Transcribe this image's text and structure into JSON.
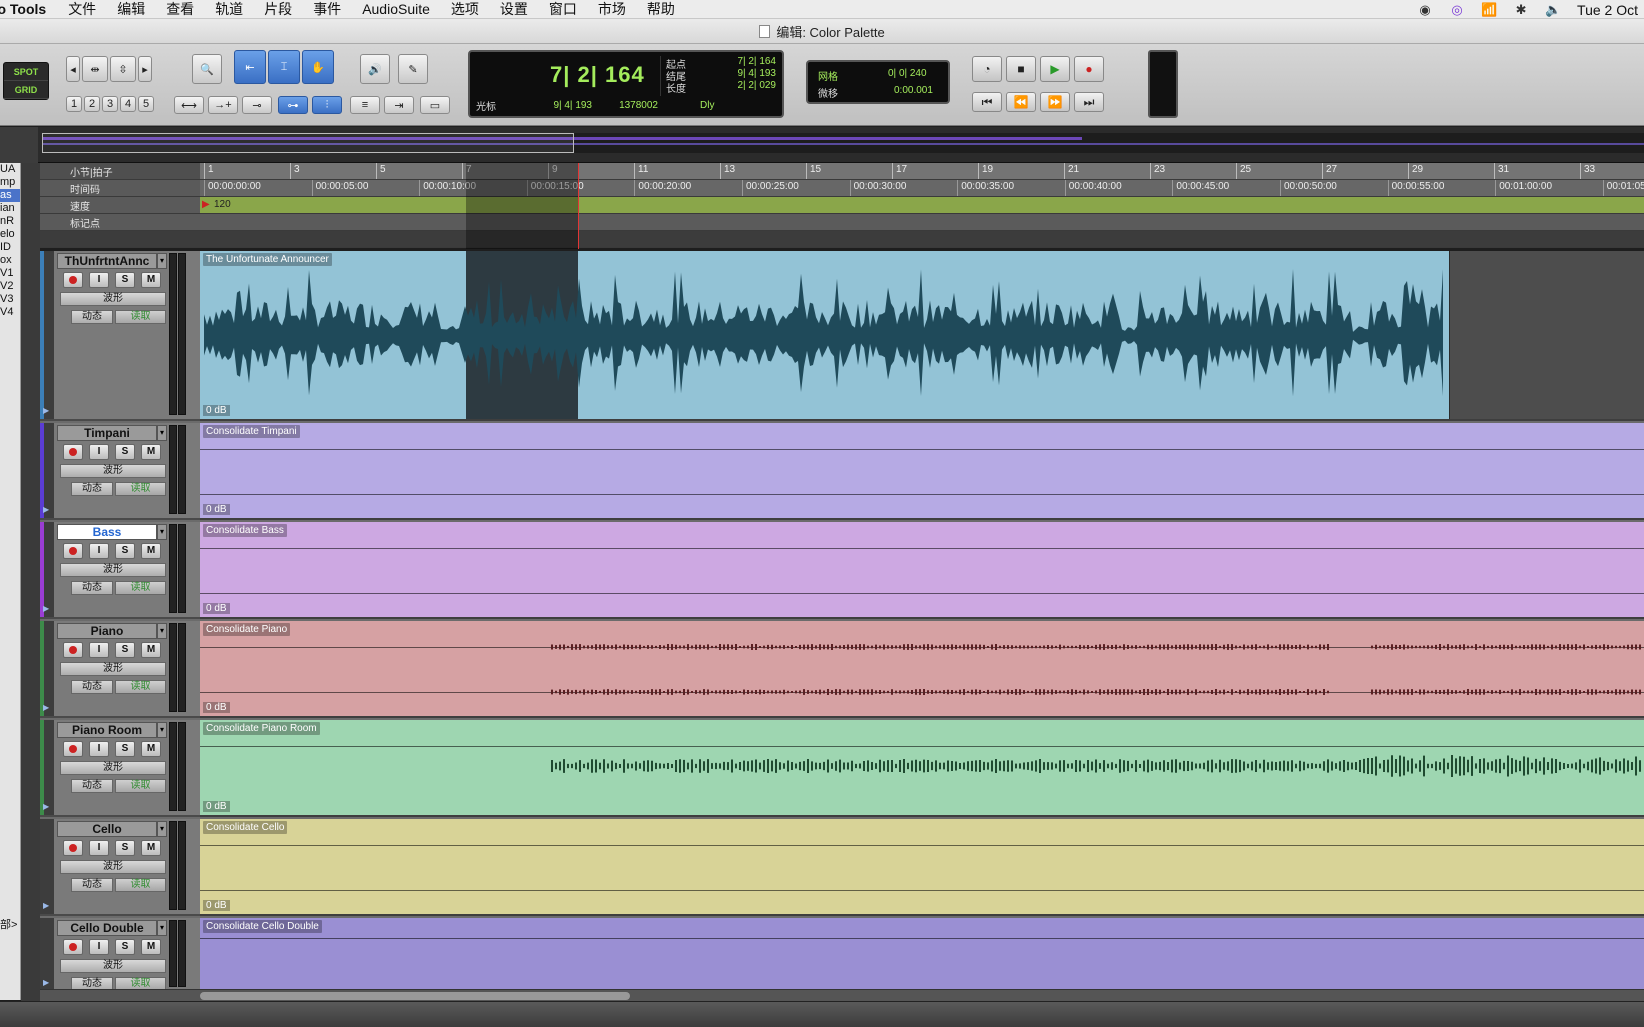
{
  "menubar": {
    "app": "ro Tools",
    "items": [
      "文件",
      "编辑",
      "查看",
      "轨道",
      "片段",
      "事件",
      "AudioSuite",
      "选项",
      "设置",
      "窗口",
      "市场",
      "帮助"
    ],
    "clock": "Tue 2 Oct"
  },
  "window": {
    "title": "编辑: Color Palette"
  },
  "toolbar": {
    "mode_spot": "SPOT",
    "mode_grid": "GRID",
    "zoom_presets": [
      "1",
      "2",
      "3",
      "4",
      "5"
    ],
    "counter_main": "7| 2| 164",
    "counter_cursor_label": "光标",
    "counter_cursor": "9| 4| 193",
    "counter_sample": "1378002",
    "counter_dly": "Dly",
    "start_label": "起点",
    "end_label": "结尾",
    "length_label": "长度",
    "start_value": "7| 2| 164",
    "end_value": "9| 4| 193",
    "length_value": "2| 2| 029",
    "grid_label": "网格",
    "grid_value": "0| 0| 240",
    "nudge_label": "微移",
    "nudge_value": "0:00.001"
  },
  "clip_list": [
    "UA",
    "mp",
    "as",
    "ian",
    "nR",
    "elo",
    "ID",
    "ox",
    "V1",
    "V2",
    "V3",
    "V4"
  ],
  "clip_list_footer": "部>",
  "rulers": {
    "bars_label": "小节|拍子",
    "timecode_label": "时间码",
    "tempo_label": "速度",
    "markers_label": "标记点",
    "tempo_value": "120",
    "bar_ticks": [
      "1",
      "3",
      "5",
      "7",
      "9",
      "11",
      "13",
      "15",
      "17",
      "19",
      "21",
      "23",
      "25",
      "27",
      "29",
      "31",
      "33"
    ],
    "time_ticks": [
      "00:00:00:00",
      "00:00:05:00",
      "00:00:10:00",
      "00:00:15:00",
      "00:00:20:00",
      "00:00:25:00",
      "00:00:30:00",
      "00:00:35:00",
      "00:00:40:00",
      "00:00:45:00",
      "00:00:50:00",
      "00:00:55:00",
      "00:01:00:00",
      "00:01:05"
    ]
  },
  "track_controls": {
    "view": "波形",
    "dyn": "动态",
    "auto": "读取",
    "solo": "S",
    "mute": "M",
    "input": "I"
  },
  "tracks": [
    {
      "name": "ThUnfrtntAnnc",
      "clip": "The Unfortunate Announcer",
      "gain": "0 dB",
      "color": "#93c3d6",
      "bar": "#3c7fb8"
    },
    {
      "name": "Timpani",
      "clip": "Consolidate Timpani",
      "gain": "0 dB",
      "color": "#b6aae4",
      "bar": "#5b3dd4"
    },
    {
      "name": "Bass",
      "clip": "Consolidate Bass",
      "gain": "0 dB",
      "color": "#cda8e2",
      "bar": "#9a3dd4"
    },
    {
      "name": "Piano",
      "clip": "Consolidate Piano",
      "gain": "0 dB",
      "color": "#d6a1a3",
      "bar": "#3d8b4a"
    },
    {
      "name": "Piano Room",
      "clip": "Consolidate Piano Room",
      "gain": "0 dB",
      "color": "#9ed6b1",
      "bar": "#3d8b4a"
    },
    {
      "name": "Cello",
      "clip": "Consolidate Cello",
      "gain": "0 dB",
      "color": "#d8d397",
      "bar": "#3d3d3d"
    },
    {
      "name": "Cello Double",
      "clip": "Consolidate Cello Double",
      "gain": "",
      "color": "#9a8fd3",
      "bar": "#3d3d3d"
    }
  ]
}
